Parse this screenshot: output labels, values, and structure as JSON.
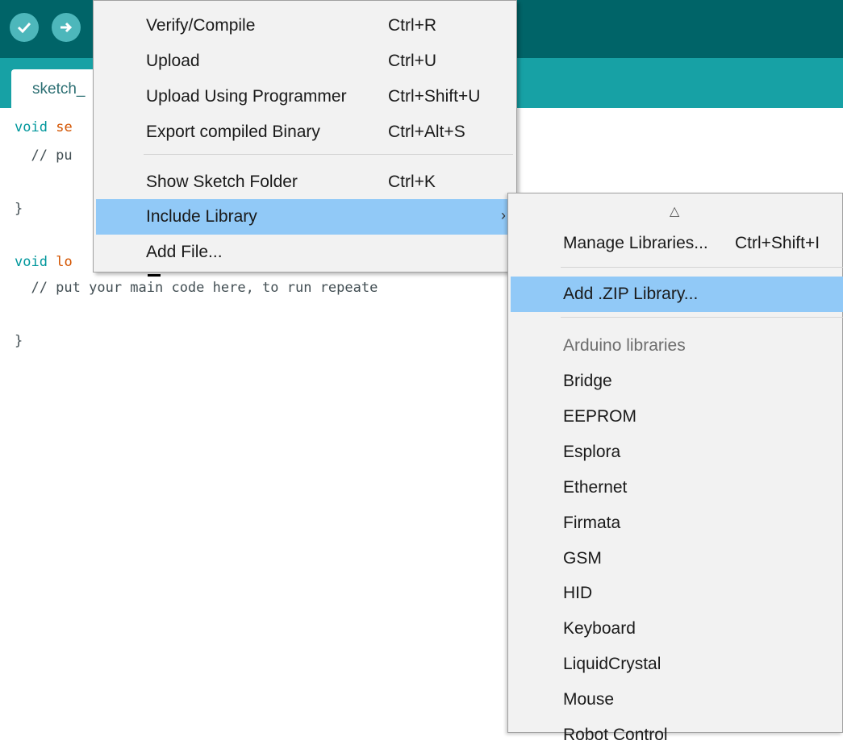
{
  "tab": {
    "label": "sketch_"
  },
  "code": {
    "line1_type": "void",
    "line1_fn": "se",
    "line2": "  // pu",
    "line3": "}",
    "line4_type": "void",
    "line4_fn": "lo",
    "line5": "  // put your main code here, to run repeate",
    "line6": "}"
  },
  "sketch_menu": {
    "items": [
      {
        "label": "Verify/Compile",
        "shortcut": "Ctrl+R"
      },
      {
        "label": "Upload",
        "shortcut": "Ctrl+U"
      },
      {
        "label": "Upload Using Programmer",
        "shortcut": "Ctrl+Shift+U"
      },
      {
        "label": "Export compiled Binary",
        "shortcut": "Ctrl+Alt+S"
      },
      {
        "label": "Show Sketch Folder",
        "shortcut": "Ctrl+K"
      },
      {
        "label": "Include Library",
        "arrow": "›"
      },
      {
        "label": "Add File..."
      }
    ]
  },
  "include_library_menu": {
    "scroll_indicator": "△",
    "manage": {
      "label": "Manage Libraries...",
      "shortcut": "Ctrl+Shift+I"
    },
    "add_zip": {
      "label": "Add .ZIP Library..."
    },
    "section_header": "Arduino libraries",
    "libraries": [
      "Bridge",
      "EEPROM",
      "Esplora",
      "Ethernet",
      "Firmata",
      "GSM",
      "HID",
      "Keyboard",
      "LiquidCrystal",
      "Mouse",
      "Robot Control"
    ]
  },
  "colors": {
    "toolbar": "#006468",
    "tabbar": "#17a1a5",
    "highlight": "#91c9f7",
    "menu_bg": "#f2f2f2"
  },
  "icons": {
    "verify": "checkmark-icon",
    "upload": "arrow-right-icon"
  }
}
